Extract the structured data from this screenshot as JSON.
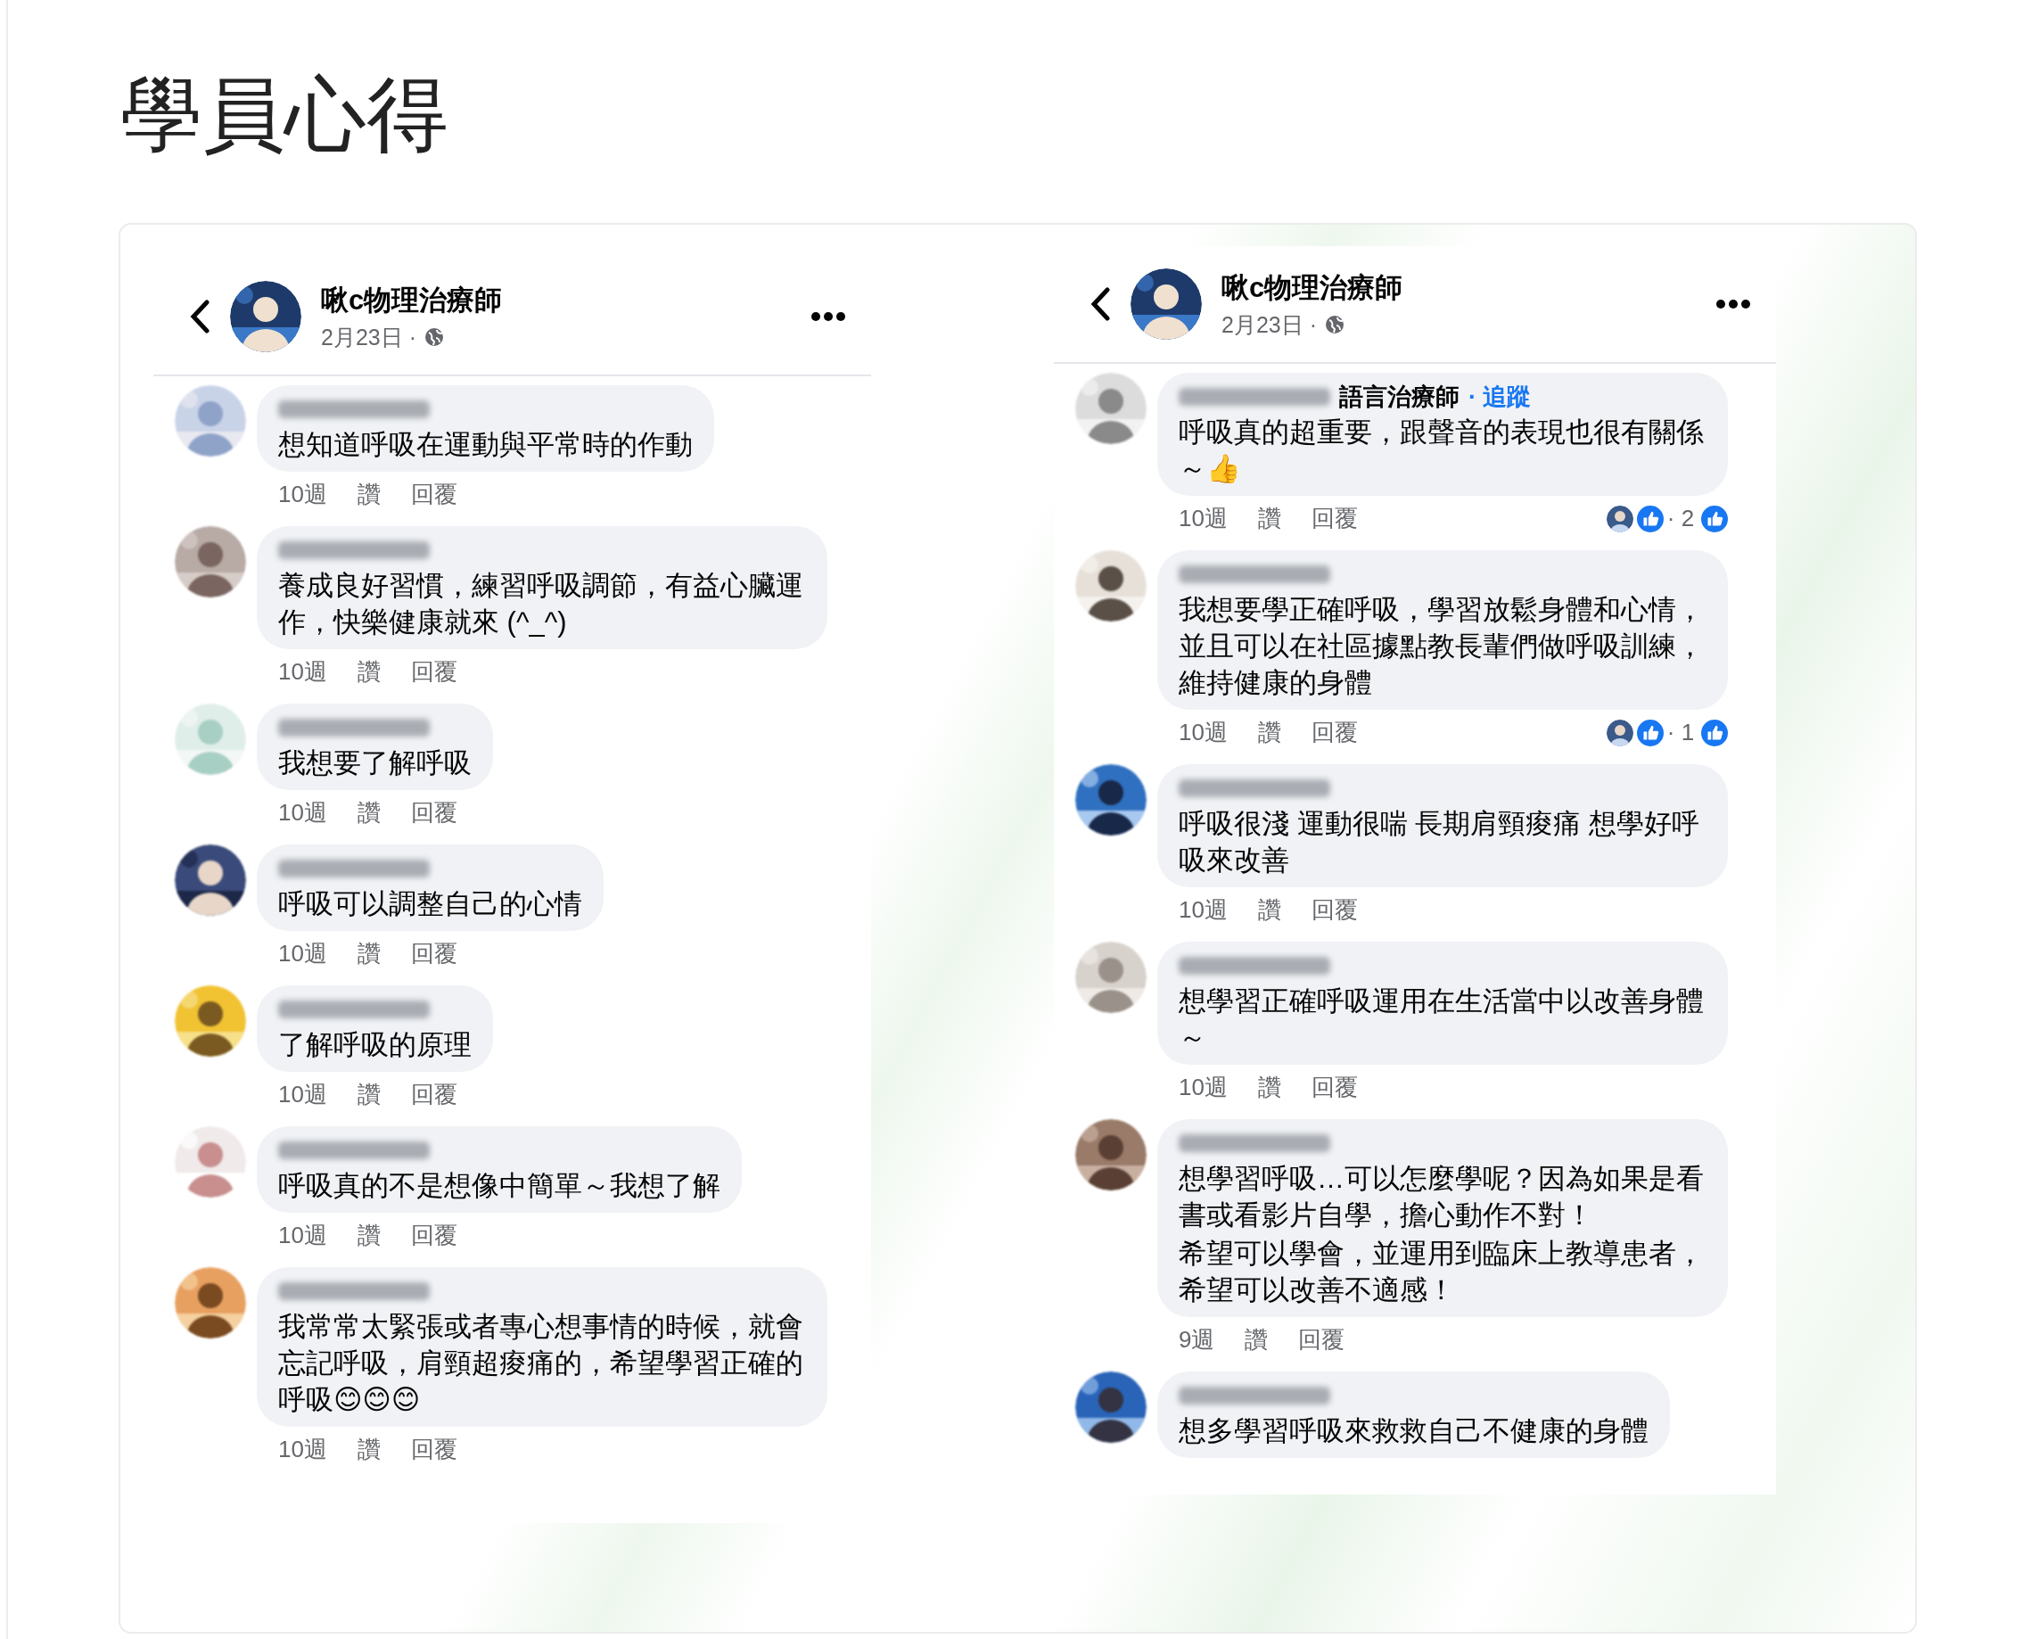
{
  "page_title": "學員心得",
  "posts": [
    {
      "author": "啾c物理治療師",
      "date": "2月23日 ·",
      "comments": [
        {
          "text": "想知道呼吸在運動與平常時的作動",
          "time": "10週",
          "like": "讚",
          "reply": "回覆"
        },
        {
          "text": "養成良好習慣，練習呼吸調節，有益心臟運作，快樂健康就來 (^_^)",
          "time": "10週",
          "like": "讚",
          "reply": "回覆"
        },
        {
          "text": "我想要了解呼吸",
          "time": "10週",
          "like": "讚",
          "reply": "回覆"
        },
        {
          "text": "呼吸可以調整自己的心情",
          "time": "10週",
          "like": "讚",
          "reply": "回覆"
        },
        {
          "text": "了解呼吸的原理",
          "time": "10週",
          "like": "讚",
          "reply": "回覆"
        },
        {
          "text": "呼吸真的不是想像中簡單～我想了解",
          "time": "10週",
          "like": "讚",
          "reply": "回覆"
        },
        {
          "text": "我常常太緊張或者專心想事情的時候，就會忘記呼吸，肩頸超痠痛的，希望學習正確的呼吸😊😊😊",
          "time": "10週",
          "like": "讚",
          "reply": "回覆"
        }
      ]
    },
    {
      "author": "啾c物理治療師",
      "date": "2月23日 ·",
      "comments": [
        {
          "author_title": "語言治療師",
          "follow": "· 追蹤",
          "text": "呼吸真的超重要，跟聲音的表現也很有關係～👍",
          "time": "10週",
          "like": "讚",
          "reply": "回覆",
          "reaction_count": "· 2"
        },
        {
          "text": "我想要學正確呼吸，學習放鬆身體和心情，並且可以在社區據點教長輩們做呼吸訓練，維持健康的身體",
          "time": "10週",
          "like": "讚",
          "reply": "回覆",
          "reaction_count": "· 1"
        },
        {
          "text": "呼吸很淺 運動很喘 長期肩頸痠痛 想學好呼吸來改善",
          "time": "10週",
          "like": "讚",
          "reply": "回覆"
        },
        {
          "text": "想學習正確呼吸運用在生活當中以改善身體～",
          "time": "10週",
          "like": "讚",
          "reply": "回覆"
        },
        {
          "text": "想學習呼吸…可以怎麼學呢？因為如果是看書或看影片自學，擔心動作不對！",
          "text_2": "希望可以學會，並運用到臨床上教導患者，希望可以改善不適感！",
          "time": "9週",
          "like": "讚",
          "reply": "回覆"
        },
        {
          "text": "想多學習呼吸來救救自己不健康的身體"
        }
      ]
    }
  ]
}
